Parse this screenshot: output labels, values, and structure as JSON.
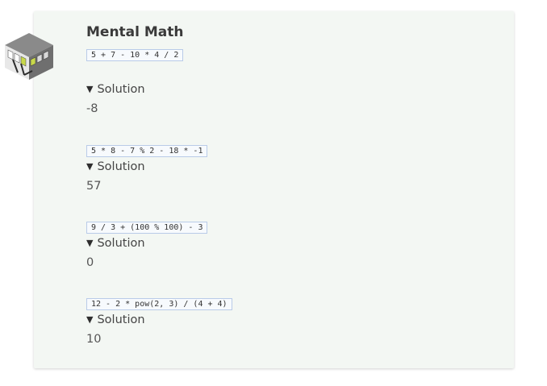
{
  "page": {
    "title": "Mental Math",
    "badge_icon": "rubiks-cube-icon"
  },
  "problems": [
    {
      "expression": "5 + 7 - 10 * 4 / 2",
      "toggle": "Solution",
      "answer": "-8"
    },
    {
      "expression": "5 * 8 - 7 % 2 - 18 * -1",
      "toggle": "Solution",
      "answer": "57"
    },
    {
      "expression": "9 / 3 + (100 % 100) - 3",
      "toggle": "Solution",
      "answer": "0"
    },
    {
      "expression": "12 - 2 * pow(2, 3) / (4 + 4)",
      "toggle": "Solution",
      "answer": "10"
    }
  ],
  "colors": {
    "card_bg": "#f3f7f3",
    "code_border": "#b9cbe8"
  }
}
